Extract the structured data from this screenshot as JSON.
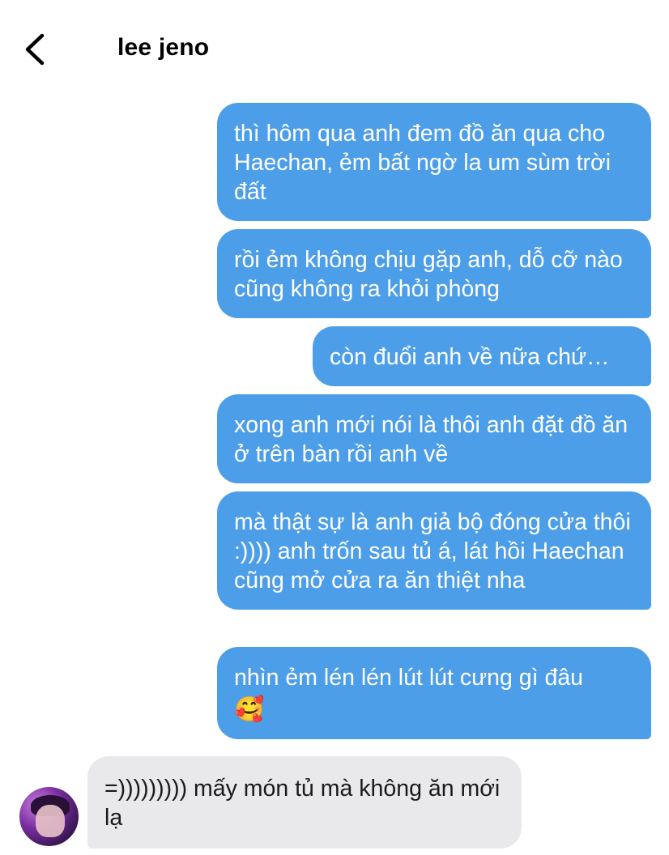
{
  "header": {
    "contact_name": "lee jeno"
  },
  "messages": [
    {
      "direction": "sent",
      "text": "thì hôm qua anh đem đồ ăn qua cho Haechan, ẻm bất ngờ la um sùm trời đất"
    },
    {
      "direction": "sent",
      "text": "rồi ẻm không chịu gặp anh, dỗ cỡ nào cũng không ra khỏi phòng"
    },
    {
      "direction": "sent",
      "text": "còn đuổi anh về nữa chứ…"
    },
    {
      "direction": "sent",
      "text": "xong anh mới nói là thôi anh đặt đồ ăn ở trên bàn rồi anh về"
    },
    {
      "direction": "sent",
      "text": "mà thật sự là anh giả bộ đóng cửa thôi :)))) anh trốn sau tủ á, lát hồi Haechan cũng mở cửa ra ăn thiệt nha"
    },
    {
      "direction": "sent",
      "text": "nhìn ẻm lén lén lút lút cưng gì đâu",
      "emoji": "🥰"
    },
    {
      "direction": "received",
      "text": "=))))))))) mấy món tủ mà không ăn mới lạ"
    }
  ],
  "colors": {
    "sent_bubble": "#4d9ee8",
    "received_bubble": "#e9e9eb"
  },
  "icons": {
    "back": "chevron-left-icon",
    "avatar": "contact-avatar"
  }
}
